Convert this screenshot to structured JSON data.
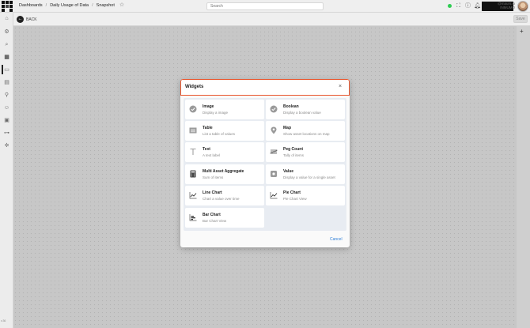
{
  "topbar": {
    "breadcrumb": [
      "Dashboards",
      "Daily Usage of Data",
      "Snapshot"
    ],
    "search_placeholder": "Search",
    "user_text": "@maurs.io INMUMO"
  },
  "subheader": {
    "back_label": "BACK",
    "save_label": "Save"
  },
  "sidebar": {
    "icons": [
      "home-icon",
      "gear-icon",
      "search-icon",
      "dashboard-icon",
      "folder-icon",
      "document-icon",
      "map-icon",
      "people-icon",
      "boxes-icon",
      "tree-icon",
      "settings-icon"
    ],
    "version": "v.36"
  },
  "modal": {
    "title": "Widgets",
    "close_glyph": "×",
    "cancel_label": "Cancel",
    "widgets": [
      {
        "title": "Image",
        "description": "Display a image",
        "icon": "check-circle-icon"
      },
      {
        "title": "Boolean",
        "description": "Display a boolean value",
        "icon": "check-circle-icon"
      },
      {
        "title": "Table",
        "description": "List a table of values",
        "icon": "table-icon"
      },
      {
        "title": "Map",
        "description": "Show asset locations on map",
        "icon": "map-pin-icon"
      },
      {
        "title": "Text",
        "description": "A text label",
        "icon": "text-icon"
      },
      {
        "title": "Peg Count",
        "description": "Tally of items",
        "icon": "tally-icon"
      },
      {
        "title": "Multi Asset Aggregate",
        "description": "Sum of items",
        "icon": "calculator-icon"
      },
      {
        "title": "Value",
        "description": "Display a value for a single asset",
        "icon": "value-icon"
      },
      {
        "title": "Line Chart",
        "description": "Chart a value over time",
        "icon": "line-chart-icon"
      },
      {
        "title": "Pie Chart",
        "description": "Pie Chart View",
        "icon": "pie-chart-icon"
      },
      {
        "title": "Bar Chart",
        "description": "Bar Chart View",
        "icon": "bar-chart-icon"
      }
    ]
  }
}
